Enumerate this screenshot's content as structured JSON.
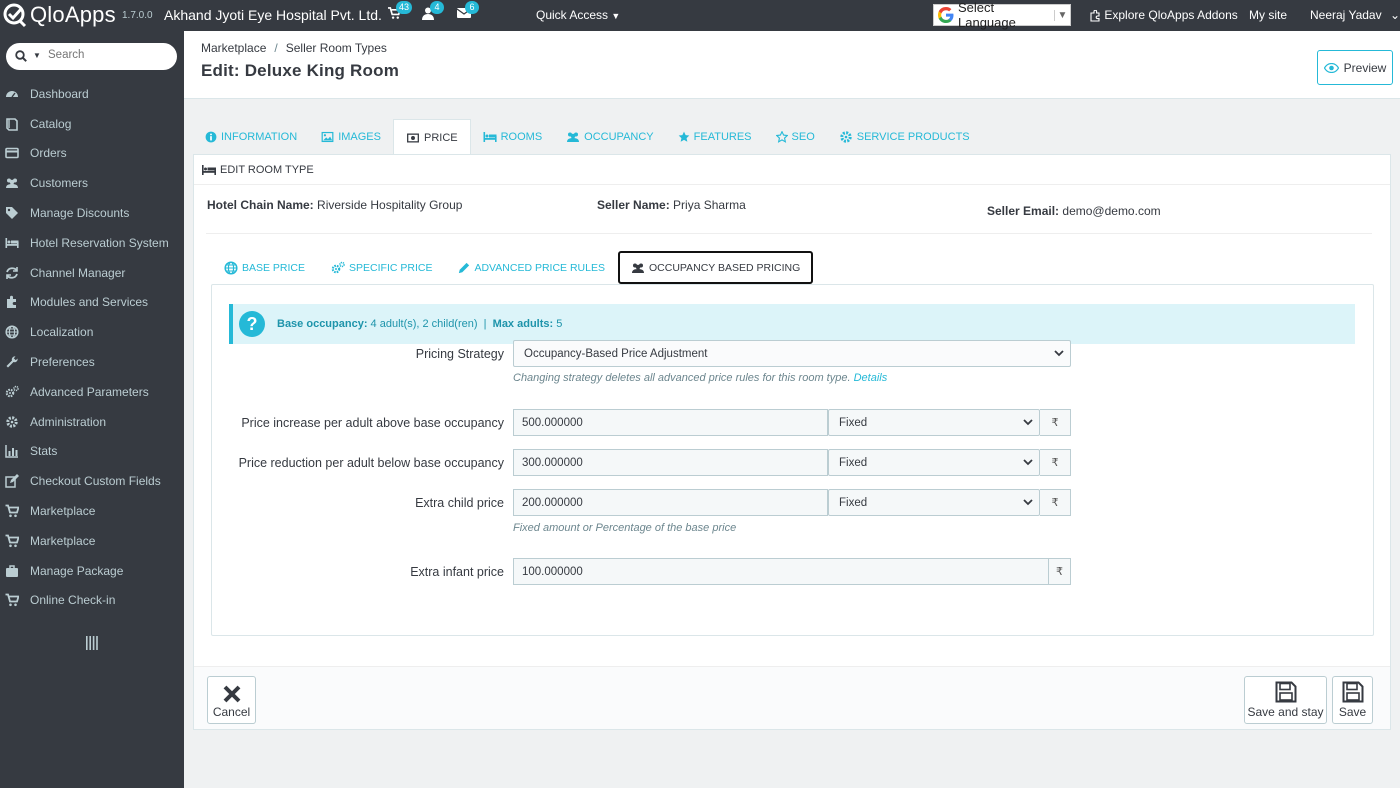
{
  "topbar": {
    "app_name": "QloApps",
    "version": "1.7.0.0",
    "shop_name": "Akhand Jyoti Eye Hospital Pvt. Ltd.",
    "orders_count": "43",
    "customers_count": "4",
    "messages_count": "6",
    "quick_access": "Quick Access",
    "language": "Select Language",
    "explore_addons": "Explore QloApps Addons",
    "my_site": "My site",
    "user": "Neeraj Yadav"
  },
  "sidebar": {
    "search_placeholder": "Search",
    "items": [
      {
        "label": "Dashboard",
        "icon": "dashboard-icon"
      },
      {
        "label": "Catalog",
        "icon": "catalog-icon"
      },
      {
        "label": "Orders",
        "icon": "orders-icon"
      },
      {
        "label": "Customers",
        "icon": "customers-icon"
      },
      {
        "label": "Manage Discounts",
        "icon": "tag-icon"
      },
      {
        "label": "Hotel Reservation System",
        "icon": "bed-icon"
      },
      {
        "label": "Channel Manager",
        "icon": "sync-icon"
      },
      {
        "label": "Modules and Services",
        "icon": "puzzle-icon"
      },
      {
        "label": "Localization",
        "icon": "globe-icon"
      },
      {
        "label": "Preferences",
        "icon": "wrench-icon"
      },
      {
        "label": "Advanced Parameters",
        "icon": "cogs-icon"
      },
      {
        "label": "Administration",
        "icon": "gear-icon"
      },
      {
        "label": "Stats",
        "icon": "bar-chart-icon"
      },
      {
        "label": "Checkout Custom Fields",
        "icon": "edit-icon"
      },
      {
        "label": "Marketplace",
        "icon": "cart-icon"
      },
      {
        "label": "Marketplace",
        "icon": "cart-icon"
      },
      {
        "label": "Manage Package",
        "icon": "briefcase-icon"
      },
      {
        "label": "Online Check-in",
        "icon": "cart-icon"
      }
    ]
  },
  "header": {
    "breadcrumb": [
      "Marketplace",
      "Seller Room Types"
    ],
    "title": "Edit: Deluxe King Room",
    "preview_label": "Preview"
  },
  "tabs": [
    {
      "label": "Information",
      "icon": "info-icon"
    },
    {
      "label": "Images",
      "icon": "image-icon"
    },
    {
      "label": "Price",
      "icon": "money-icon"
    },
    {
      "label": "Rooms",
      "icon": "bed-icon"
    },
    {
      "label": "Occupancy",
      "icon": "users-icon"
    },
    {
      "label": "Features",
      "icon": "star-icon"
    },
    {
      "label": "SEO",
      "icon": "star-outline-icon"
    },
    {
      "label": "Service Products",
      "icon": "gear-icon"
    }
  ],
  "active_tab": "Price",
  "panel": {
    "heading": "Edit Room Type",
    "hotel_chain_label": "Hotel Chain Name:",
    "hotel_chain_value": "Riverside Hospitality Group",
    "seller_name_label": "Seller Name:",
    "seller_name_value": "Priya Sharma",
    "seller_email_label": "Seller Email:",
    "seller_email_value": "demo@demo.com"
  },
  "price_tabs": [
    {
      "label": "Base Price",
      "icon": "globe-icon"
    },
    {
      "label": "Specific Price",
      "icon": "cogs-icon"
    },
    {
      "label": "Advanced Price Rules",
      "icon": "pencil-icon"
    },
    {
      "label": "Occupancy Based Pricing",
      "icon": "users-icon"
    }
  ],
  "active_price_tab": "Occupancy Based Pricing",
  "alert": {
    "base_label": "Base occupancy:",
    "base_value": "4 adult(s), 2 child(ren)",
    "separator": "|",
    "max_label": "Max adults:",
    "max_value": "5"
  },
  "form": {
    "strategy_label": "Pricing Strategy",
    "strategy_value": "Occupancy-Based Price Adjustment",
    "strategy_help": "Changing strategy deletes all advanced price rules for this room type.",
    "strategy_help_link": "Details",
    "adult_increase_label": "Price increase per adult above base occupancy",
    "adult_increase_value": "500.000000",
    "adult_increase_type": "Fixed",
    "adult_reduction_label": "Price reduction per adult below base occupancy",
    "adult_reduction_value": "300.000000",
    "adult_reduction_type": "Fixed",
    "child_label": "Extra child price",
    "child_value": "200.000000",
    "child_type": "Fixed",
    "child_help": "Fixed amount or Percentage of the base price",
    "infant_label": "Extra infant price",
    "infant_value": "100.000000",
    "currency": "₹"
  },
  "footer": {
    "cancel": "Cancel",
    "save_and_stay": "Save and stay",
    "save": "Save"
  },
  "colors": {
    "accent": "#25b9d7",
    "sidebar_bg": "#363a41",
    "alert_bg": "#dcf4f9"
  }
}
